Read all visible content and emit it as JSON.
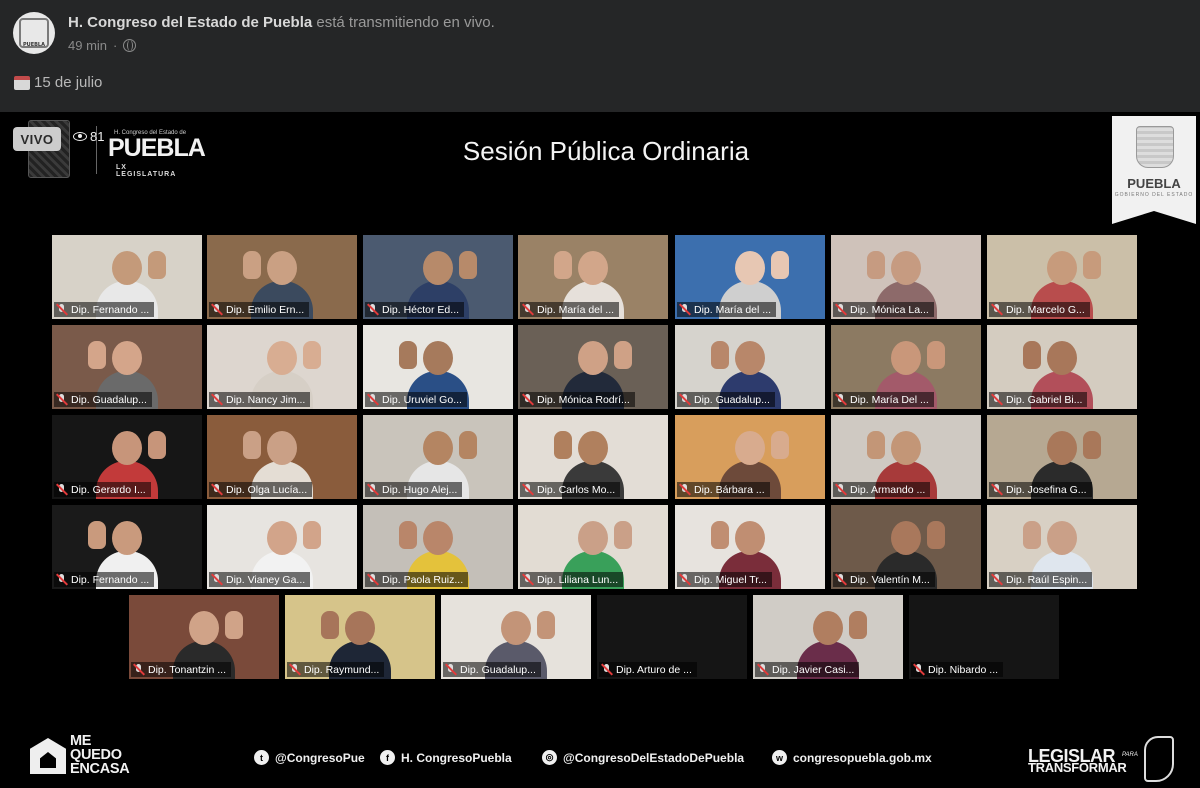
{
  "post": {
    "page_name": "H. Congreso del Estado de Puebla",
    "status": "está transmitiendo en vivo.",
    "time": "49 min",
    "text": "15 de julio",
    "avatar_text": "PUEBLA"
  },
  "video": {
    "live_label": "VIVO",
    "viewers": "81",
    "title": "Sesión Pública Ordinaria",
    "logo": {
      "small": "H. Congreso del Estado de",
      "big": "PUEBLA",
      "legislature": "LX LEGISLATURA"
    },
    "banner": {
      "text": "PUEBLA",
      "sub": "GOBIERNO DEL ESTADO"
    }
  },
  "participants": [
    {
      "name": "Dip. Fernando ...",
      "bg": "#d7d2c8",
      "skin": "#c49a7a",
      "shirt": "#e8e8e8"
    },
    {
      "name": "Dip. Emilio Ern...",
      "bg": "#8a6a4c",
      "skin": "#caa083",
      "shirt": "#3b4a5e"
    },
    {
      "name": "Dip. Héctor Ed...",
      "bg": "#4b5a70",
      "skin": "#b78a6a",
      "shirt": "#2d3f66"
    },
    {
      "name": "Dip. María del ...",
      "bg": "#9a8266",
      "skin": "#d2a68a",
      "shirt": "#e6e0da"
    },
    {
      "name": "Dip. María del ...",
      "bg": "#3c6fae",
      "skin": "#e7c7b3",
      "shirt": "#cfcfcf"
    },
    {
      "name": "Dip. Mónica La...",
      "bg": "#cfc2ba",
      "skin": "#c69b81",
      "shirt": "#8d6a6a"
    },
    {
      "name": "Dip. Marcelo G...",
      "bg": "#cbbfa8",
      "skin": "#c79b7c",
      "shirt": "#b84d4d"
    },
    {
      "name": "Dip. Guadalup...",
      "bg": "#7a5a4a",
      "skin": "#d4a58a",
      "shirt": "#6a6a6a"
    },
    {
      "name": "Dip. Nancy Jim...",
      "bg": "#ddd6cf",
      "skin": "#d8ad92",
      "shirt": "#d6cfc6"
    },
    {
      "name": "Dip. Uruviel Go...",
      "bg": "#e8e6e1",
      "skin": "#a67a5c",
      "shirt": "#2a4f86"
    },
    {
      "name": "Dip. Mónica Rodrí...",
      "bg": "#6a6056",
      "skin": "#cfa186",
      "shirt": "#222a3a"
    },
    {
      "name": "Dip. Guadalup...",
      "bg": "#d6d3cd",
      "skin": "#b8876a",
      "shirt": "#2d3b6d"
    },
    {
      "name": "Dip. María Del ...",
      "bg": "#8c7a62",
      "skin": "#c9977a",
      "shirt": "#a35a6a"
    },
    {
      "name": "Dip. Gabriel Bi...",
      "bg": "#d4ccc0",
      "skin": "#a8775a",
      "shirt": "#b24f5a"
    },
    {
      "name": "Dip. Gerardo I...",
      "bg": "#161616",
      "skin": "#c7957a",
      "shirt": "#c23a3a"
    },
    {
      "name": "Dip. Olga Lucía...",
      "bg": "#8a5c3c",
      "skin": "#caa086",
      "shirt": "#e4ddd4"
    },
    {
      "name": "Dip. Hugo Alej...",
      "bg": "#c9c4bb",
      "skin": "#b48562",
      "shirt": "#e6e6e6"
    },
    {
      "name": "Dip. Carlos Mo...",
      "bg": "#e3ddd6",
      "skin": "#b0805e",
      "shirt": "#3a3a3a"
    },
    {
      "name": "Dip. Bárbara ...",
      "bg": "#d89e5c",
      "skin": "#d8ab8e",
      "shirt": "#6d4a3a"
    },
    {
      "name": "Dip. Armando ...",
      "bg": "#cfc9c2",
      "skin": "#c39677",
      "shirt": "#a73a3a"
    },
    {
      "name": "Dip. Josefina G...",
      "bg": "#b6a892",
      "skin": "#a9785a",
      "shirt": "#2b2b2b"
    },
    {
      "name": "Dip. Fernando ...",
      "bg": "#1a1a1a",
      "skin": "#c99a7d",
      "shirt": "#f0f0f0"
    },
    {
      "name": "Dip. Vianey Ga...",
      "bg": "#e7e4e0",
      "skin": "#d2a48a",
      "shirt": "#f2f2f2"
    },
    {
      "name": "Dip. Paola Ruiz...",
      "bg": "#c4bfb8",
      "skin": "#b9866a",
      "shirt": "#e4c23b"
    },
    {
      "name": "Dip. Liliana Lun...",
      "bg": "#e2dcd3",
      "skin": "#caa088",
      "shirt": "#39a05a"
    },
    {
      "name": "Dip. Miguel Tr...",
      "bg": "#e7e3de",
      "skin": "#c08e72",
      "shirt": "#7a2d3a"
    },
    {
      "name": "Dip. Valentín M...",
      "bg": "#6e5a4a",
      "skin": "#a9785c",
      "shirt": "#2a2a2a"
    },
    {
      "name": "Dip. Raúl Espin...",
      "bg": "#d8d0c4",
      "skin": "#caa088",
      "shirt": "#dfe6ee"
    },
    {
      "name": "Dip. Tonantzin ...",
      "bg": "#7a4a3a",
      "skin": "#d0a388",
      "shirt": "#2a2a2a"
    },
    {
      "name": "Dip. Raymund...",
      "bg": "#d6c48a",
      "skin": "#a7755a",
      "shirt": "#1e2636"
    },
    {
      "name": "Dip. Guadalup...",
      "bg": "#e6e2dc",
      "skin": "#c39478",
      "shirt": "#5a5a6a"
    },
    {
      "name": "Dip. Arturo de ...",
      "bg": "#151515",
      "skin": "",
      "shirt": ""
    },
    {
      "name": "Dip. Javier Casi...",
      "bg": "#d0ccc6",
      "skin": "#b07e60",
      "shirt": "#6a2d4a"
    },
    {
      "name": "Dip. Nibardo ...",
      "bg": "#151515",
      "skin": "",
      "shirt": ""
    }
  ],
  "footer": {
    "campaign": [
      "ME",
      "QUEDO",
      "ENCASA"
    ],
    "twitter": "@CongresoPue",
    "facebook": "H. CongresoPuebla",
    "instagram": "@CongresoDelEstadoDePuebla",
    "web": "congresopuebla.gob.mx",
    "slogan_a": "LEGISLAR",
    "slogan_para": "PARA",
    "slogan_b": "TRANSFORMAR",
    "icons": {
      "twitter": "twitter-icon",
      "facebook": "facebook-icon",
      "instagram": "instagram-icon",
      "web": "www-icon"
    }
  },
  "colors": {
    "active_speaker": "#c8d946",
    "muted": "#e23b3b",
    "video_bg": "#000000"
  }
}
